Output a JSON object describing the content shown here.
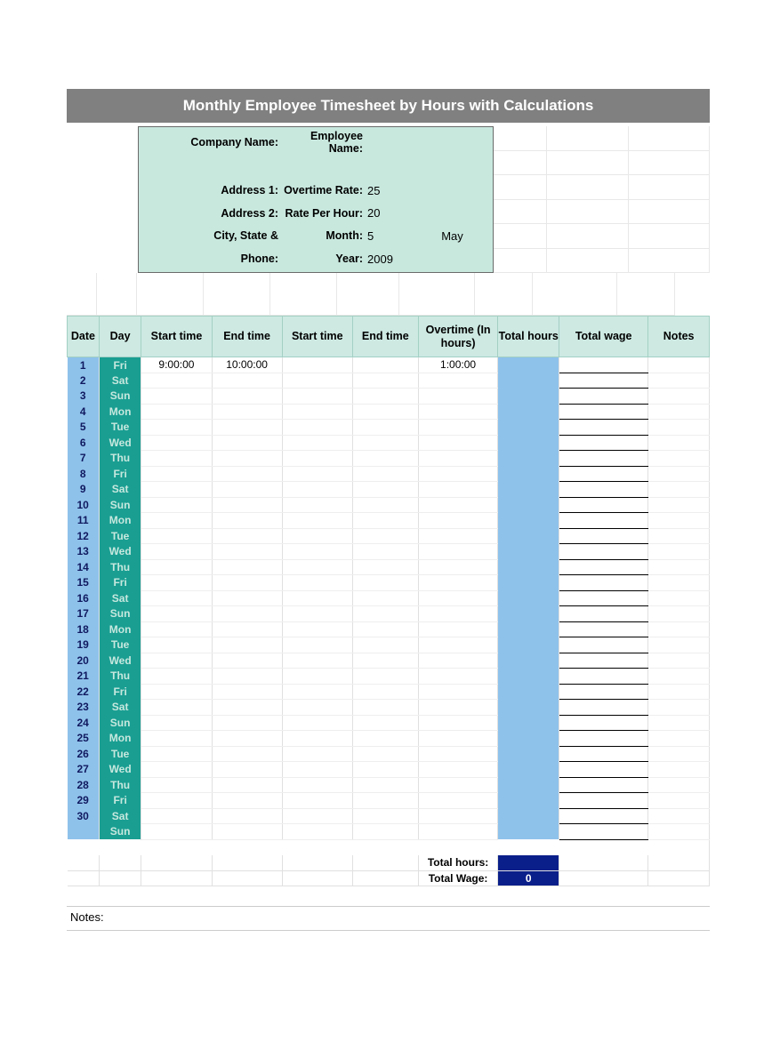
{
  "title": "Monthly Employee Timesheet by Hours with Calculations",
  "info": {
    "company_label": "Company Name:",
    "employee_label": "Employee Name:",
    "addr1_label": "Address 1:",
    "addr2_label": "Address 2:",
    "csz_label": "City, State &",
    "phone_label": "Phone:",
    "ot_rate_label": "Overtime Rate:",
    "ot_rate": "25",
    "rate_hour_label": "Rate Per Hour:",
    "rate_hour": "20",
    "month_label": "Month:",
    "month_num": "5",
    "month_name": "May",
    "year_label": "Year:",
    "year": "2009"
  },
  "headers": {
    "date": "Date",
    "day": "Day",
    "start1": "Start time",
    "end1": "End time",
    "start2": "Start time",
    "end2": "End time",
    "ot": "Overtime (In hours)",
    "thours": "Total hours",
    "twage": "Total wage",
    "notes": "Notes"
  },
  "rows": [
    {
      "date": "1",
      "day": "Fri",
      "start1": "9:00:00",
      "end1": "10:00:00",
      "start2": "",
      "end2": "",
      "ot": "1:00:00"
    },
    {
      "date": "2",
      "day": "Sat",
      "start1": "",
      "end1": "",
      "start2": "",
      "end2": "",
      "ot": ""
    },
    {
      "date": "3",
      "day": "Sun",
      "start1": "",
      "end1": "",
      "start2": "",
      "end2": "",
      "ot": ""
    },
    {
      "date": "4",
      "day": "Mon",
      "start1": "",
      "end1": "",
      "start2": "",
      "end2": "",
      "ot": ""
    },
    {
      "date": "5",
      "day": "Tue",
      "start1": "",
      "end1": "",
      "start2": "",
      "end2": "",
      "ot": ""
    },
    {
      "date": "6",
      "day": "Wed",
      "start1": "",
      "end1": "",
      "start2": "",
      "end2": "",
      "ot": ""
    },
    {
      "date": "7",
      "day": "Thu",
      "start1": "",
      "end1": "",
      "start2": "",
      "end2": "",
      "ot": ""
    },
    {
      "date": "8",
      "day": "Fri",
      "start1": "",
      "end1": "",
      "start2": "",
      "end2": "",
      "ot": ""
    },
    {
      "date": "9",
      "day": "Sat",
      "start1": "",
      "end1": "",
      "start2": "",
      "end2": "",
      "ot": ""
    },
    {
      "date": "10",
      "day": "Sun",
      "start1": "",
      "end1": "",
      "start2": "",
      "end2": "",
      "ot": ""
    },
    {
      "date": "11",
      "day": "Mon",
      "start1": "",
      "end1": "",
      "start2": "",
      "end2": "",
      "ot": ""
    },
    {
      "date": "12",
      "day": "Tue",
      "start1": "",
      "end1": "",
      "start2": "",
      "end2": "",
      "ot": ""
    },
    {
      "date": "13",
      "day": "Wed",
      "start1": "",
      "end1": "",
      "start2": "",
      "end2": "",
      "ot": ""
    },
    {
      "date": "14",
      "day": "Thu",
      "start1": "",
      "end1": "",
      "start2": "",
      "end2": "",
      "ot": ""
    },
    {
      "date": "15",
      "day": "Fri",
      "start1": "",
      "end1": "",
      "start2": "",
      "end2": "",
      "ot": ""
    },
    {
      "date": "16",
      "day": "Sat",
      "start1": "",
      "end1": "",
      "start2": "",
      "end2": "",
      "ot": ""
    },
    {
      "date": "17",
      "day": "Sun",
      "start1": "",
      "end1": "",
      "start2": "",
      "end2": "",
      "ot": ""
    },
    {
      "date": "18",
      "day": "Mon",
      "start1": "",
      "end1": "",
      "start2": "",
      "end2": "",
      "ot": ""
    },
    {
      "date": "19",
      "day": "Tue",
      "start1": "",
      "end1": "",
      "start2": "",
      "end2": "",
      "ot": ""
    },
    {
      "date": "20",
      "day": "Wed",
      "start1": "",
      "end1": "",
      "start2": "",
      "end2": "",
      "ot": ""
    },
    {
      "date": "21",
      "day": "Thu",
      "start1": "",
      "end1": "",
      "start2": "",
      "end2": "",
      "ot": ""
    },
    {
      "date": "22",
      "day": "Fri",
      "start1": "",
      "end1": "",
      "start2": "",
      "end2": "",
      "ot": ""
    },
    {
      "date": "23",
      "day": "Sat",
      "start1": "",
      "end1": "",
      "start2": "",
      "end2": "",
      "ot": ""
    },
    {
      "date": "24",
      "day": "Sun",
      "start1": "",
      "end1": "",
      "start2": "",
      "end2": "",
      "ot": ""
    },
    {
      "date": "25",
      "day": "Mon",
      "start1": "",
      "end1": "",
      "start2": "",
      "end2": "",
      "ot": ""
    },
    {
      "date": "26",
      "day": "Tue",
      "start1": "",
      "end1": "",
      "start2": "",
      "end2": "",
      "ot": ""
    },
    {
      "date": "27",
      "day": "Wed",
      "start1": "",
      "end1": "",
      "start2": "",
      "end2": "",
      "ot": ""
    },
    {
      "date": "28",
      "day": "Thu",
      "start1": "",
      "end1": "",
      "start2": "",
      "end2": "",
      "ot": ""
    },
    {
      "date": "29",
      "day": "Fri",
      "start1": "",
      "end1": "",
      "start2": "",
      "end2": "",
      "ot": ""
    },
    {
      "date": "30",
      "day": "Sat",
      "start1": "",
      "end1": "",
      "start2": "",
      "end2": "",
      "ot": ""
    },
    {
      "date": "",
      "day": "Sun",
      "start1": "",
      "end1": "",
      "start2": "",
      "end2": "",
      "ot": ""
    }
  ],
  "totals": {
    "hours_label": "Total hours:",
    "hours_value": "",
    "wage_label": "Total Wage:",
    "wage_value": "0"
  },
  "notes_label": "Notes:"
}
